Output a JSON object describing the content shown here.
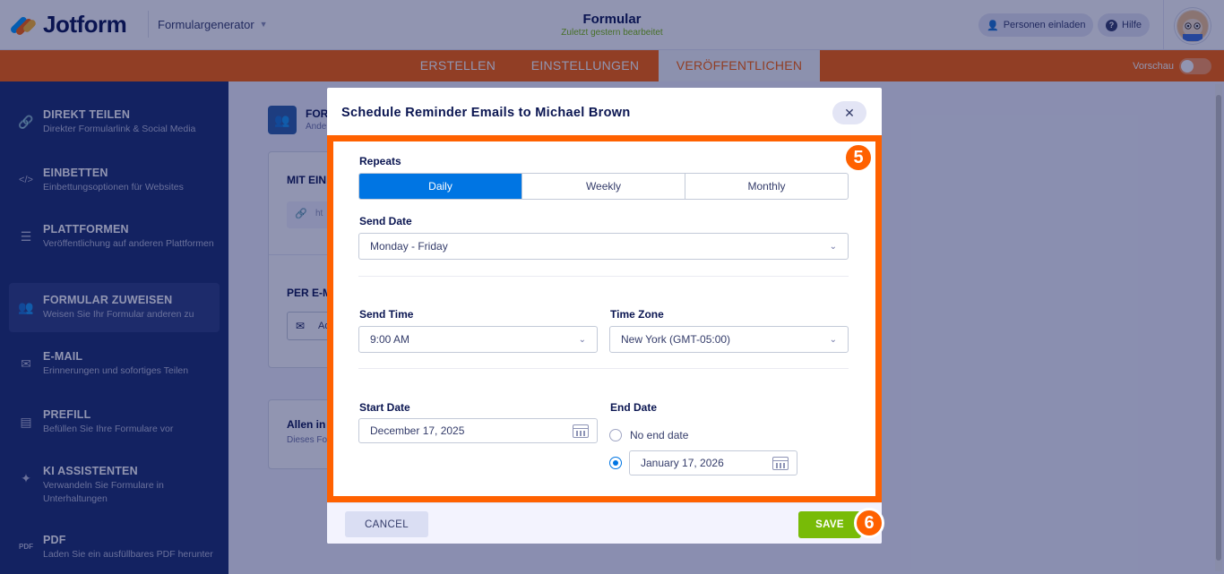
{
  "header": {
    "brand": "Jotform",
    "form_generator": "Formulargenerator",
    "title": "Formular",
    "subtitle": "Zuletzt gestern bearbeitet",
    "invite": "Personen einladen",
    "help": "Hilfe"
  },
  "tabs": [
    {
      "label": "ERSTELLEN"
    },
    {
      "label": "EINSTELLUNGEN"
    },
    {
      "label": "VERÖFFENTLICHEN"
    }
  ],
  "preview_label": "Vorschau",
  "sidebar": {
    "items": [
      {
        "title": "DIREKT TEILEN",
        "desc": "Direkter Formularlink & Social Media"
      },
      {
        "title": "EINBETTEN",
        "desc": "Einbettungsoptionen für Websites"
      },
      {
        "title": "PLATTFORMEN",
        "desc": "Veröffentlichung auf anderen Plattformen"
      },
      {
        "title": "FORMULAR ZUWEISEN",
        "desc": "Weisen Sie Ihr Formular anderen zu"
      },
      {
        "title": "E-MAIL",
        "desc": "Erinnerungen und sofortiges Teilen"
      },
      {
        "title": "PREFILL",
        "desc": "Befüllen Sie Ihre Formulare vor"
      },
      {
        "title": "KI ASSISTENTEN",
        "desc": "Verwandeln Sie Formulare in Unterhaltungen"
      },
      {
        "title": "PDF",
        "desc": "Laden Sie ein ausfüllbares PDF herunter"
      }
    ]
  },
  "background": {
    "heading_prefix": "FOR",
    "heading_sub_prefix": "Ande",
    "mit_ein": "MIT EIN",
    "link_prefix": "ht",
    "per_email": "PER E-M",
    "add_prefix": "Ad",
    "allen_in": "Allen in",
    "dieses": "Dieses Fo"
  },
  "modal": {
    "title": "Schedule Reminder Emails to Michael Brown",
    "repeats_label": "Repeats",
    "repeat_options": [
      {
        "label": "Daily"
      },
      {
        "label": "Weekly"
      },
      {
        "label": "Monthly"
      }
    ],
    "repeat_selected": "Daily",
    "send_date_label": "Send Date",
    "send_date_value": "Monday - Friday",
    "send_time_label": "Send Time",
    "send_time_value": "9:00 AM",
    "time_zone_label": "Time Zone",
    "time_zone_value": "New York (GMT-05:00)",
    "start_date_label": "Start Date",
    "start_date_value": "December 17, 2025",
    "end_date_label": "End Date",
    "no_end_date": "No end date",
    "end_date_value": "January 17, 2026",
    "end_date_mode": "date",
    "cancel": "CANCEL",
    "save": "SAVE"
  },
  "badges": {
    "step5": "5",
    "step6": "6"
  },
  "colors": {
    "accent_orange": "#ff6100",
    "navy": "#1b2e6e",
    "blue": "#0075e3",
    "green": "#78bb07"
  }
}
